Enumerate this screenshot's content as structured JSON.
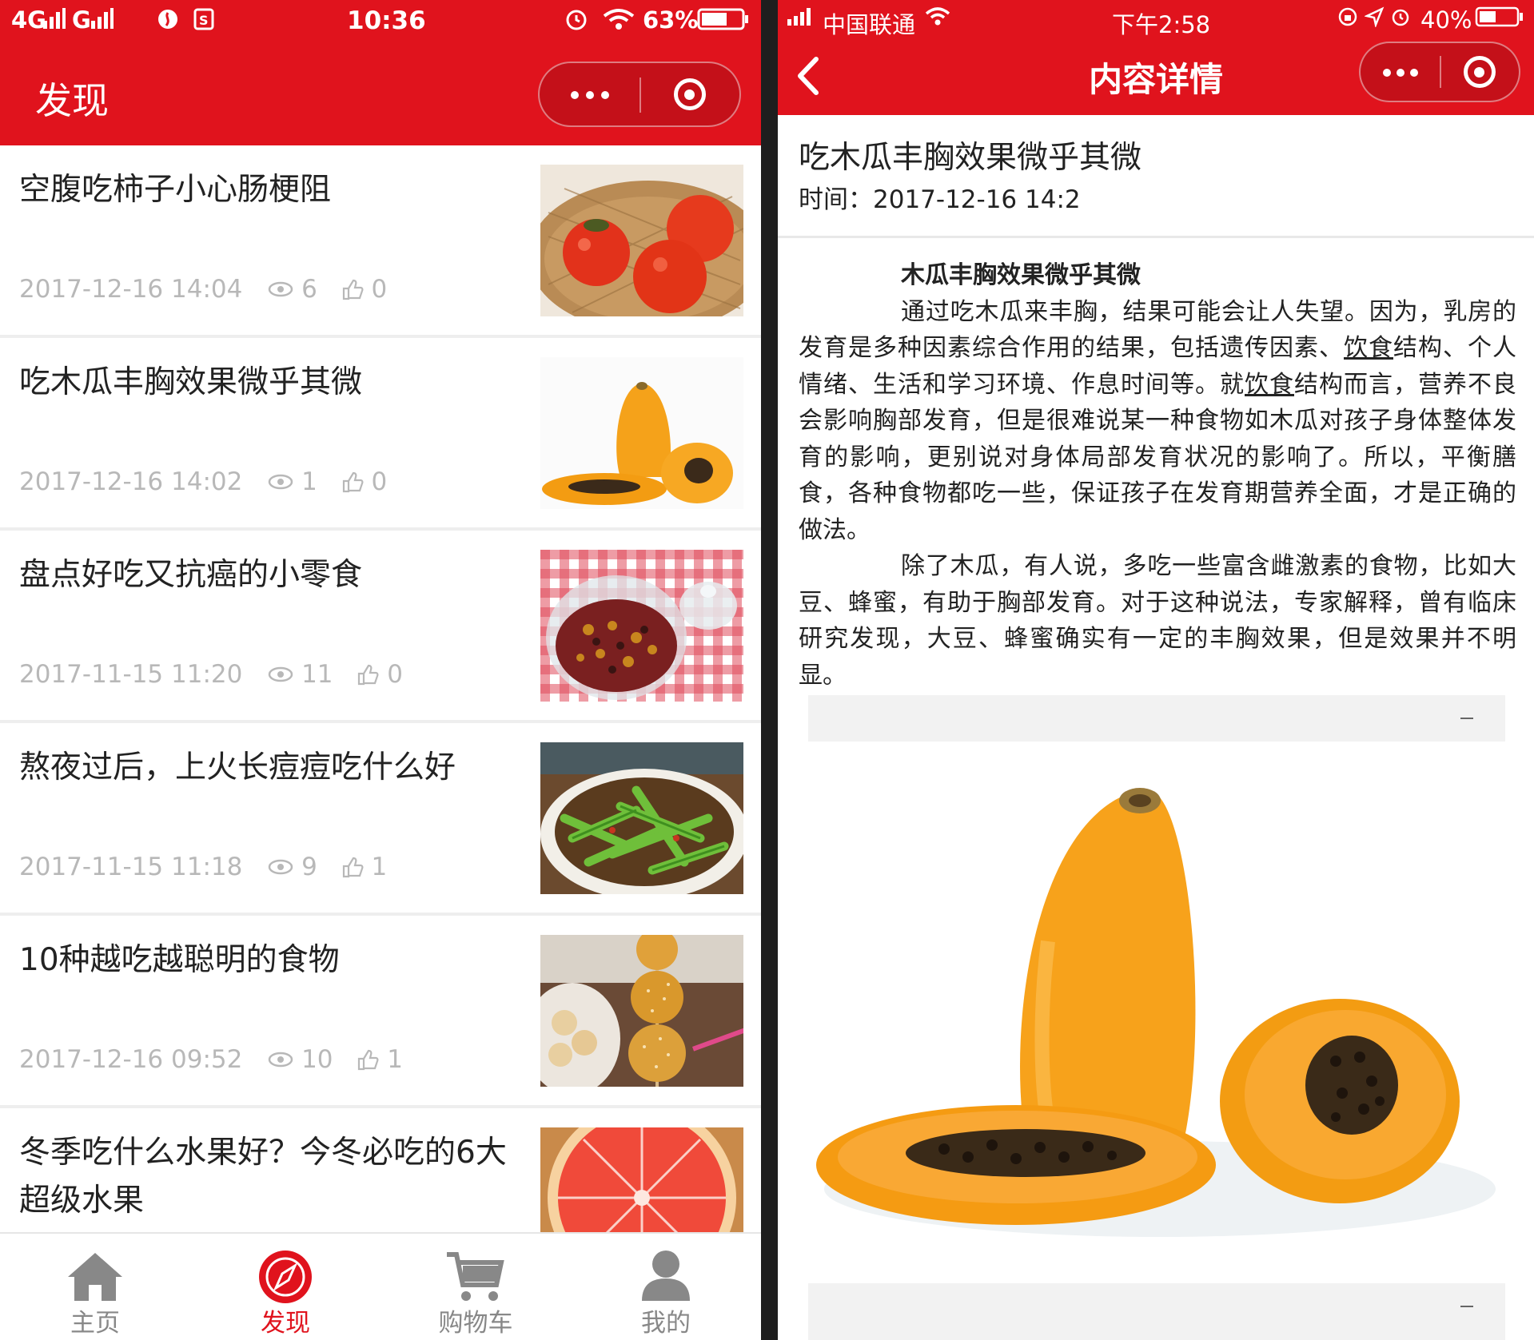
{
  "left_phone": {
    "status_bar": {
      "network": "4G",
      "network2": "G",
      "time": "10:36",
      "battery": "63%"
    },
    "nav": {
      "title": "发现"
    },
    "articles": [
      {
        "title": "空腹吃柿子小心肠梗阻",
        "date": "2017-12-16 14:04",
        "views": "6",
        "likes": "0",
        "thumb": "persimmons"
      },
      {
        "title": "吃木瓜丰胸效果微乎其微",
        "date": "2017-12-16 14:02",
        "views": "1",
        "likes": "0",
        "thumb": "papaya"
      },
      {
        "title": "盘点好吃又抗癌的小零食",
        "date": "2017-11-15 11:20",
        "views": "11",
        "likes": "0",
        "thumb": "snack-jar"
      },
      {
        "title": "熬夜过后，上火长痘痘吃什么好",
        "date": "2017-11-15 11:18",
        "views": "9",
        "likes": "1",
        "thumb": "green-beans"
      },
      {
        "title": "10种越吃越聪明的食物",
        "date": "2017-12-16 09:52",
        "views": "10",
        "likes": "1",
        "thumb": "sesame-balls"
      },
      {
        "title": "冬季吃什么水果好？今冬必吃的6大超级水果",
        "date": "",
        "views": "",
        "likes": "",
        "thumb": "grapefruit"
      }
    ],
    "tabs": [
      {
        "label": "主页",
        "icon": "home-icon"
      },
      {
        "label": "发现",
        "icon": "compass-icon"
      },
      {
        "label": "购物车",
        "icon": "cart-icon"
      },
      {
        "label": "我的",
        "icon": "user-icon"
      }
    ]
  },
  "right_phone": {
    "status_bar": {
      "carrier": "中国联通",
      "time": "下午2:58",
      "battery": "40%"
    },
    "nav": {
      "title": "内容详情"
    },
    "detail": {
      "title": "吃木瓜丰胸效果微乎其微",
      "time": "时间：2017-12-16 14:2",
      "heading": "木瓜丰胸效果微乎其微",
      "p1_a": "通过吃木瓜来丰胸，结果可能会让人失望。因为，乳房的发育是多种因素综合作用的结果，包括遗传因素、",
      "p1_link1": "饮食",
      "p1_b": "结构、个人情绪、生活和学习环境、作息时间等。就",
      "p1_link2": "饮食",
      "p1_c": "结构而言，营养不良会影响胸部发育，但是很难说某一种食物如木瓜对孩子身体整体发育的影响，更别说对身体局部发育状况的影响了。所以，平衡膳食，各种食物都吃一些，保证孩子在发育期营养全面，才是正确的做法。",
      "p2": "除了木瓜，有人说，多吃一些富含雌激素的食物，比如大豆、蜂蜜，有助于胸部发育。对于这种说法，专家解释，曾有临床研究发现，大豆、蜂蜜确实有一定的丰胸效果，但是效果并不明显。"
    }
  },
  "colors": {
    "brand_red": "#e0131d",
    "meta_gray": "#b8b8b8",
    "text": "#222222"
  }
}
